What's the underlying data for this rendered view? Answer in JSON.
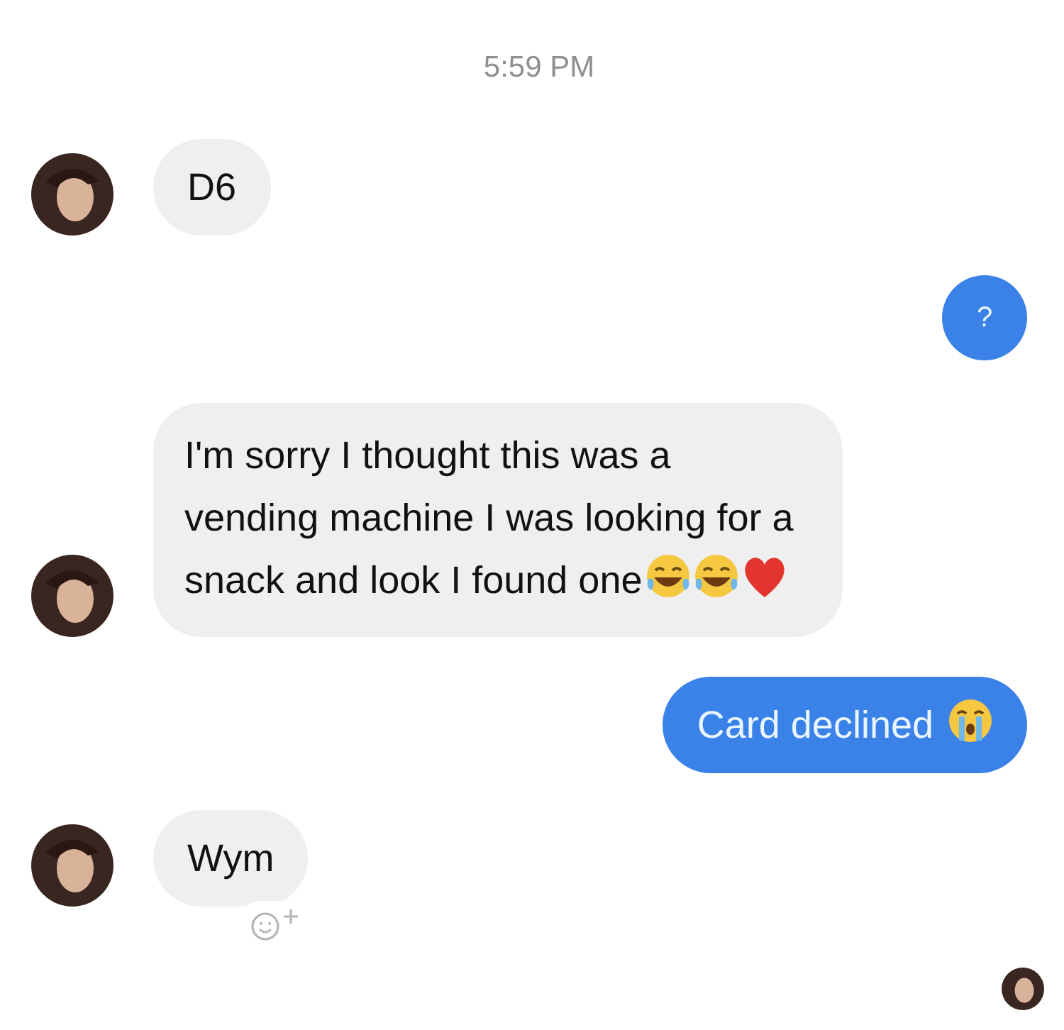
{
  "timestamp": "5:59 PM",
  "messages": [
    {
      "kind": "received",
      "text": "D6"
    },
    {
      "kind": "sent_round",
      "text": "?"
    },
    {
      "kind": "received",
      "text": "I'm sorry I thought this was a vending machine I was looking for a snack and look I found one",
      "emoji": [
        {
          "kind": "laugh"
        },
        {
          "kind": "laugh"
        },
        {
          "kind": "heart"
        }
      ]
    },
    {
      "kind": "sent",
      "text": "Card declined",
      "emoji": [
        {
          "kind": "sob"
        }
      ]
    },
    {
      "kind": "received",
      "text": "Wym",
      "reaction_button": true
    }
  ],
  "read_receipt": true
}
